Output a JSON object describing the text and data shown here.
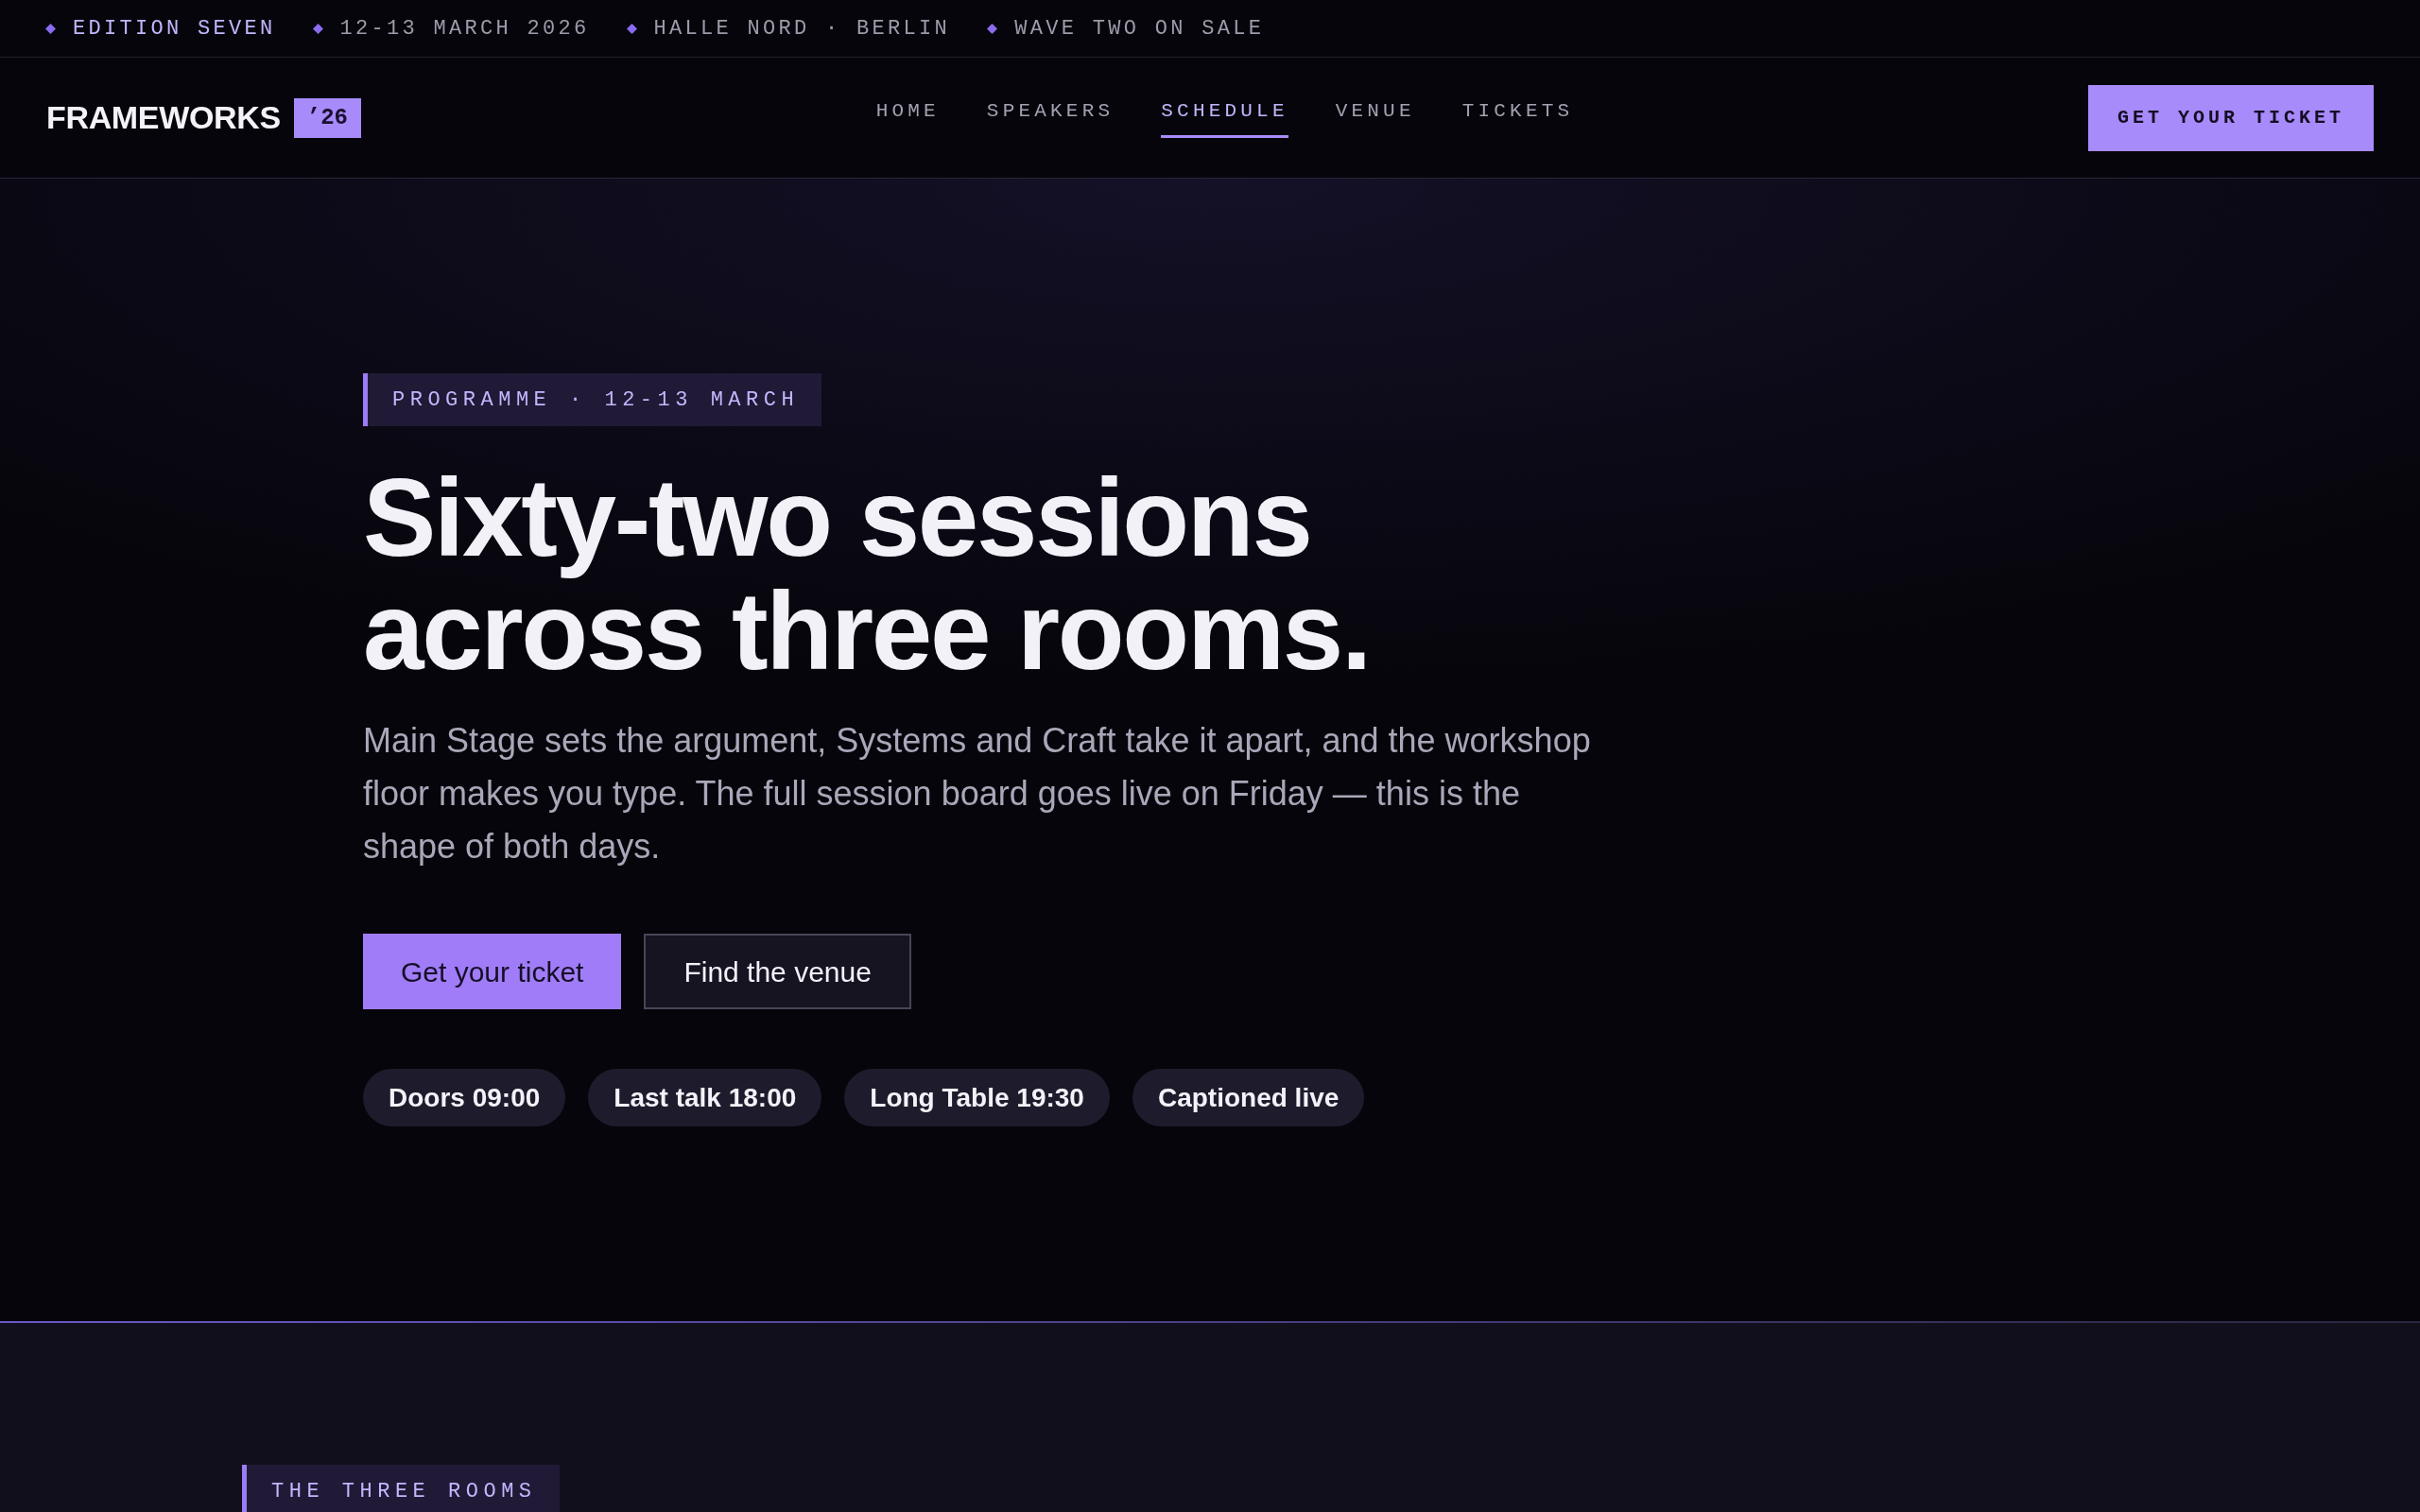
{
  "announcement_bar": {
    "items": [
      {
        "text": "EDITION SEVEN",
        "highlighted": true
      },
      {
        "text": "12-13 MARCH 2026",
        "highlighted": false
      },
      {
        "text": "HALLE NORD · BERLIN",
        "highlighted": false
      },
      {
        "text": "WAVE TWO ON SALE",
        "highlighted": false
      }
    ]
  },
  "header": {
    "logo": {
      "name": "FRAMEWORKS",
      "badge": "’26"
    },
    "nav": [
      {
        "label": "HOME",
        "selected": false
      },
      {
        "label": "SPEAKERS",
        "selected": false
      },
      {
        "label": "SCHEDULE",
        "selected": true
      },
      {
        "label": "VENUE",
        "selected": false
      },
      {
        "label": "TICKETS",
        "selected": false
      }
    ],
    "cta": "GET YOUR TICKET"
  },
  "hero": {
    "eyebrow": "PROGRAMME · 12-13 MARCH",
    "title": "Sixty-two sessions across three rooms.",
    "description": "Main Stage sets the argument, Systems and Craft take it apart, and the workshop floor makes you type. The full session board goes live on Friday — this is the shape of both days.",
    "buttons": [
      {
        "label": "Get your ticket",
        "kind": "primary"
      },
      {
        "label": "Find the venue",
        "kind": "secondary"
      }
    ],
    "facts": [
      "Doors 09:00",
      "Last talk 18:00",
      "Long Table 19:30",
      "Captioned live"
    ]
  },
  "rooms_section": {
    "eyebrow": "THE THREE ROOMS"
  }
}
